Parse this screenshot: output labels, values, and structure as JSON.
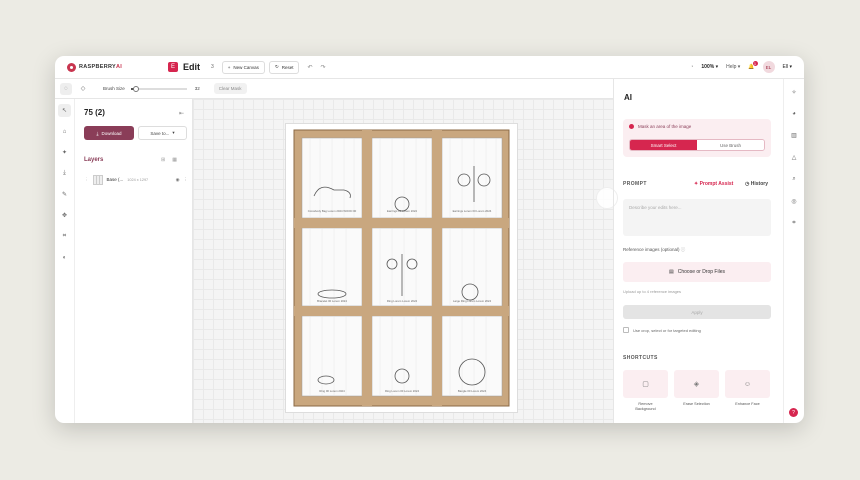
{
  "app": {
    "logo_left": "RASPBERRY",
    "logo_right": "AI",
    "edit_badge": "E",
    "edit_title": "Edit",
    "edit_count": "3",
    "new_canvas": "New Canvas",
    "reset": "Reset",
    "zoom": "100%",
    "help": "Help",
    "notif_count": "1",
    "avatar": "EL",
    "user": "Ell"
  },
  "toolbar": {
    "brush_size_label": "Brush Size",
    "brush_size_value": "32",
    "brush_size_fraction": 0.1,
    "clear_mask": "Clear Mask"
  },
  "layers_panel": {
    "title": "75 (2)",
    "download": "Download",
    "save_to": "Save to...",
    "layers_heading": "Layers",
    "layer": {
      "name": "Base (...",
      "size": "1024 x 1297"
    }
  },
  "ai": {
    "title": "AI",
    "mask_label": "Mask an area of the image",
    "smart_select": "Smart Select",
    "use_brush": "Use Brush",
    "prompt_heading": "PROMPT",
    "prompt_assist": "Prompt Assist",
    "history": "History",
    "prompt_placeholder": "Describe your edits here...",
    "reference_label": "Reference images (optional)",
    "choose_files": "Choose or Drop Files",
    "upload_note": "Upload up to 4 reference images",
    "apply": "Apply",
    "crop_label": "Use crop, select or for targeted editing",
    "shortcuts_heading": "SHORTCUTS",
    "shortcuts": [
      {
        "label1": "Remove",
        "label2": "Background"
      },
      {
        "label1": "Erase Selection",
        "label2": ""
      },
      {
        "label1": "Enhance Face",
        "label2": ""
      }
    ]
  },
  "drawing": {
    "captions": [
      "Crossbody Bag Lorem 2024 WOOD 00",
      "Earrings 00 Lorem 2024",
      "Earrings Lorem 00 Lorem 2024",
      "Bracelet 00 Lorem 2024",
      "Ring Lorem Lorem 2024",
      "Large Ring Lorem Lorem 2024",
      "Ring 00 Lorem 2024",
      "Ring Lorem 00 Lorem 2024",
      "Bangle 00 Lorem 2024"
    ]
  }
}
